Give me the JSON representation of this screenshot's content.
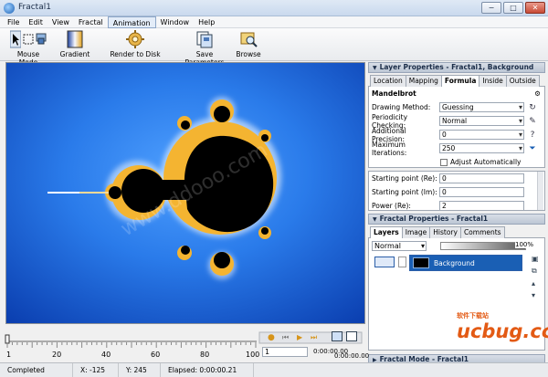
{
  "window": {
    "title": "Fractal1",
    "controls": [
      "−",
      "□",
      "✕"
    ]
  },
  "menu": [
    "File",
    "Edit",
    "View",
    "Fractal",
    "Animation",
    "Window",
    "Help"
  ],
  "toolbar": {
    "mouse_mode": "Mouse Mode",
    "gradient": "Gradient",
    "render": "Render to Disk",
    "save_params": "Save Parameters",
    "browse": "Browse"
  },
  "layer_panel": {
    "title": "Layer Properties - Fractal1, Background",
    "tabs": [
      "Location",
      "Mapping",
      "Formula",
      "Inside",
      "Outside"
    ],
    "active_tab": "Formula",
    "formula_name": "Mandelbrot",
    "rows": [
      {
        "label": "Drawing Method:",
        "value": "Guessing"
      },
      {
        "label": "Periodicity Checking:",
        "value": "Normal"
      },
      {
        "label": "Additional Precision:",
        "value": "0"
      },
      {
        "label": "Maximum Iterations:",
        "value": "250"
      }
    ],
    "adjust_auto": "Adjust Automatically",
    "params": [
      {
        "label": "Starting point (Re):",
        "value": "0"
      },
      {
        "label": "Starting point (Im):",
        "value": "0"
      },
      {
        "label": "Power (Re):",
        "value": "2"
      }
    ]
  },
  "fractal_panel": {
    "title": "Fractal Properties - Fractal1",
    "tabs": [
      "Layers",
      "Image",
      "History",
      "Comments"
    ],
    "active_tab": "Layers",
    "blend_mode": "Normal",
    "opacity": "100%",
    "layer_name": "Background"
  },
  "fractal_mode_panel": {
    "title": "Fractal Mode - Fractal1"
  },
  "timeline": {
    "ticks": [
      "1",
      "20",
      "40",
      "60",
      "80",
      "100"
    ],
    "frame": "1",
    "time_top": "0:00:00.00",
    "time_bottom": "0:00:00.00"
  },
  "status": {
    "state": "Completed",
    "x": "X: -125",
    "y": "Y: 245",
    "elapsed": "Elapsed: 0:00:00.21"
  },
  "colors": {
    "canvas_bg": "#1d6fe0",
    "accent": "#1a5fb4",
    "set": "#000000"
  },
  "watermark": {
    "brand": "ucbug.cc",
    "tagline": "软件下载站",
    "faint": "www.ddooo.com"
  }
}
